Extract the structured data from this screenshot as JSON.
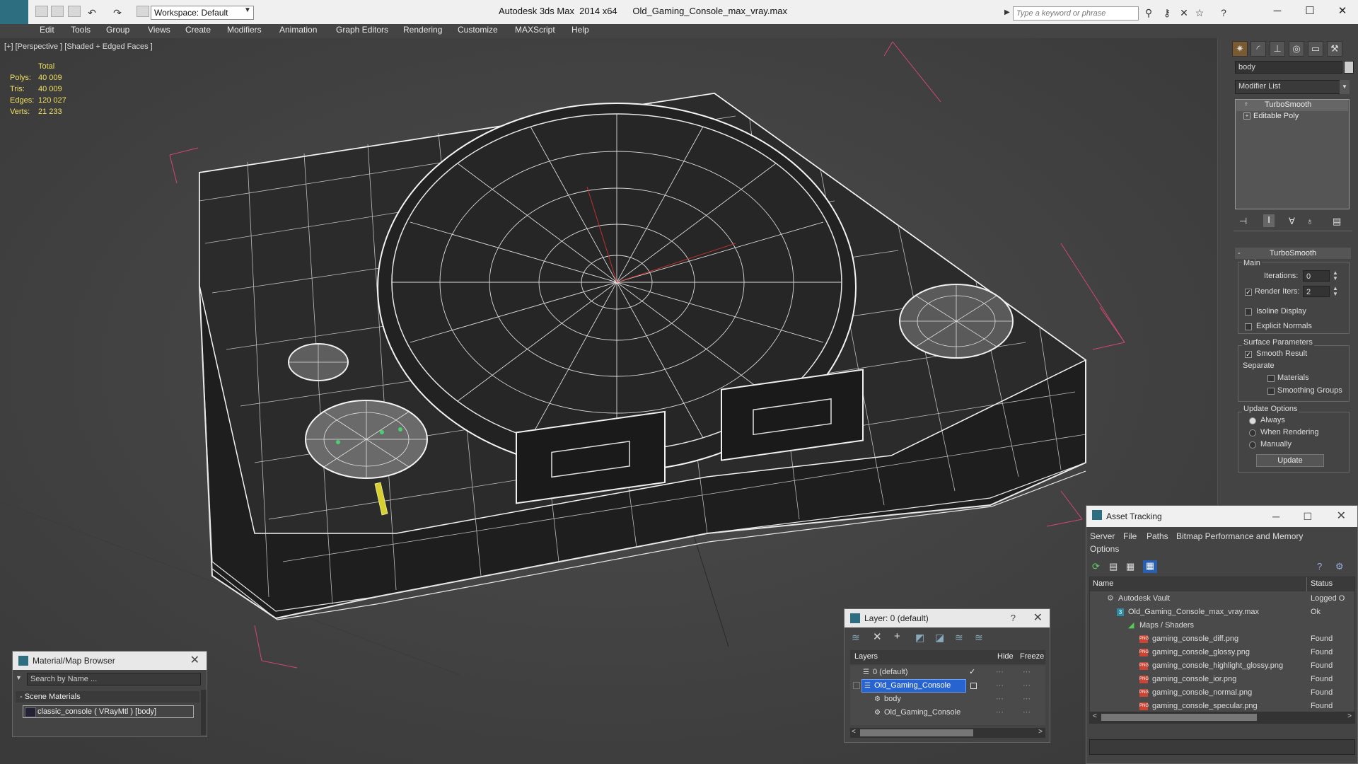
{
  "titlebar": {
    "app_title": "Autodesk 3ds Max  2014 x64      Old_Gaming_Console_max_vray.max",
    "workspace": "Workspace: Default",
    "search_placeholder": "Type a keyword or phrase"
  },
  "menus": [
    "Edit",
    "Tools",
    "Group",
    "Views",
    "Create",
    "Modifiers",
    "Animation",
    "Graph Editors",
    "Rendering",
    "Customize",
    "MAXScript",
    "Help"
  ],
  "viewport": {
    "label": "[+] [Perspective ] [Shaded + Edged Faces ]",
    "stats_header": "Total",
    "stats": [
      {
        "label": "Polys:",
        "value": "40 009"
      },
      {
        "label": "Tris:",
        "value": "40 009"
      },
      {
        "label": "Edges:",
        "value": "120 027"
      },
      {
        "label": "Verts:",
        "value": "21 233"
      }
    ]
  },
  "command_panel": {
    "object_name": "body",
    "modifier_list": "Modifier List",
    "stack": [
      "TurboSmooth",
      "Editable Poly"
    ],
    "rollout_title": "TurboSmooth",
    "main_label": "Main",
    "iterations_label": "Iterations:",
    "iterations_value": "0",
    "render_iters_label": "Render Iters:",
    "render_iters_value": "2",
    "render_iters_checked": true,
    "isoline_label": "Isoline Display",
    "explicit_normals_label": "Explicit Normals",
    "surface_params_label": "Surface Parameters",
    "smooth_result_label": "Smooth Result",
    "smooth_result_checked": true,
    "separate_label": "Separate",
    "materials_label": "Materials",
    "smoothing_groups_label": "Smoothing Groups",
    "update_options_label": "Update Options",
    "update_options": [
      "Always",
      "When Rendering",
      "Manually"
    ],
    "update_selected": "Always",
    "update_button": "Update"
  },
  "material_browser": {
    "title": "Material/Map Browser",
    "search_placeholder": "Search by Name ...",
    "section": "Scene Materials",
    "item": "classic_console ( VRayMtl ) [body]"
  },
  "layer_window": {
    "title": "Layer: 0 (default)",
    "help": "?",
    "columns": [
      "Layers",
      "Hide",
      "Freeze"
    ],
    "rows": [
      {
        "name": "0 (default)",
        "selected": false,
        "indent": 0
      },
      {
        "name": "Old_Gaming_Console",
        "selected": true,
        "indent": 0
      },
      {
        "name": "body",
        "selected": false,
        "indent": 1
      },
      {
        "name": "Old_Gaming_Console",
        "selected": false,
        "indent": 1
      }
    ]
  },
  "asset_tracking": {
    "title": "Asset Tracking",
    "menus": [
      "Server",
      "File",
      "Paths",
      "Bitmap Performance and Memory",
      "Options"
    ],
    "columns": [
      "Name",
      "Status"
    ],
    "rows": [
      {
        "name": "Autodesk Vault",
        "status": "Logged O",
        "indent": 1,
        "icon": "vault"
      },
      {
        "name": "Old_Gaming_Console_max_vray.max",
        "status": "Ok",
        "indent": 2,
        "icon": "max"
      },
      {
        "name": "Maps / Shaders",
        "status": "",
        "indent": 3,
        "icon": "folder"
      },
      {
        "name": "gaming_console_diff.png",
        "status": "Found",
        "indent": 4,
        "icon": "png"
      },
      {
        "name": "gaming_console_glossy.png",
        "status": "Found",
        "indent": 4,
        "icon": "png"
      },
      {
        "name": "gaming_console_highlight_glossy.png",
        "status": "Found",
        "indent": 4,
        "icon": "png"
      },
      {
        "name": "gaming_console_ior.png",
        "status": "Found",
        "indent": 4,
        "icon": "png"
      },
      {
        "name": "gaming_console_normal.png",
        "status": "Found",
        "indent": 4,
        "icon": "png"
      },
      {
        "name": "gaming_console_specular.png",
        "status": "Found",
        "indent": 4,
        "icon": "png"
      }
    ]
  }
}
